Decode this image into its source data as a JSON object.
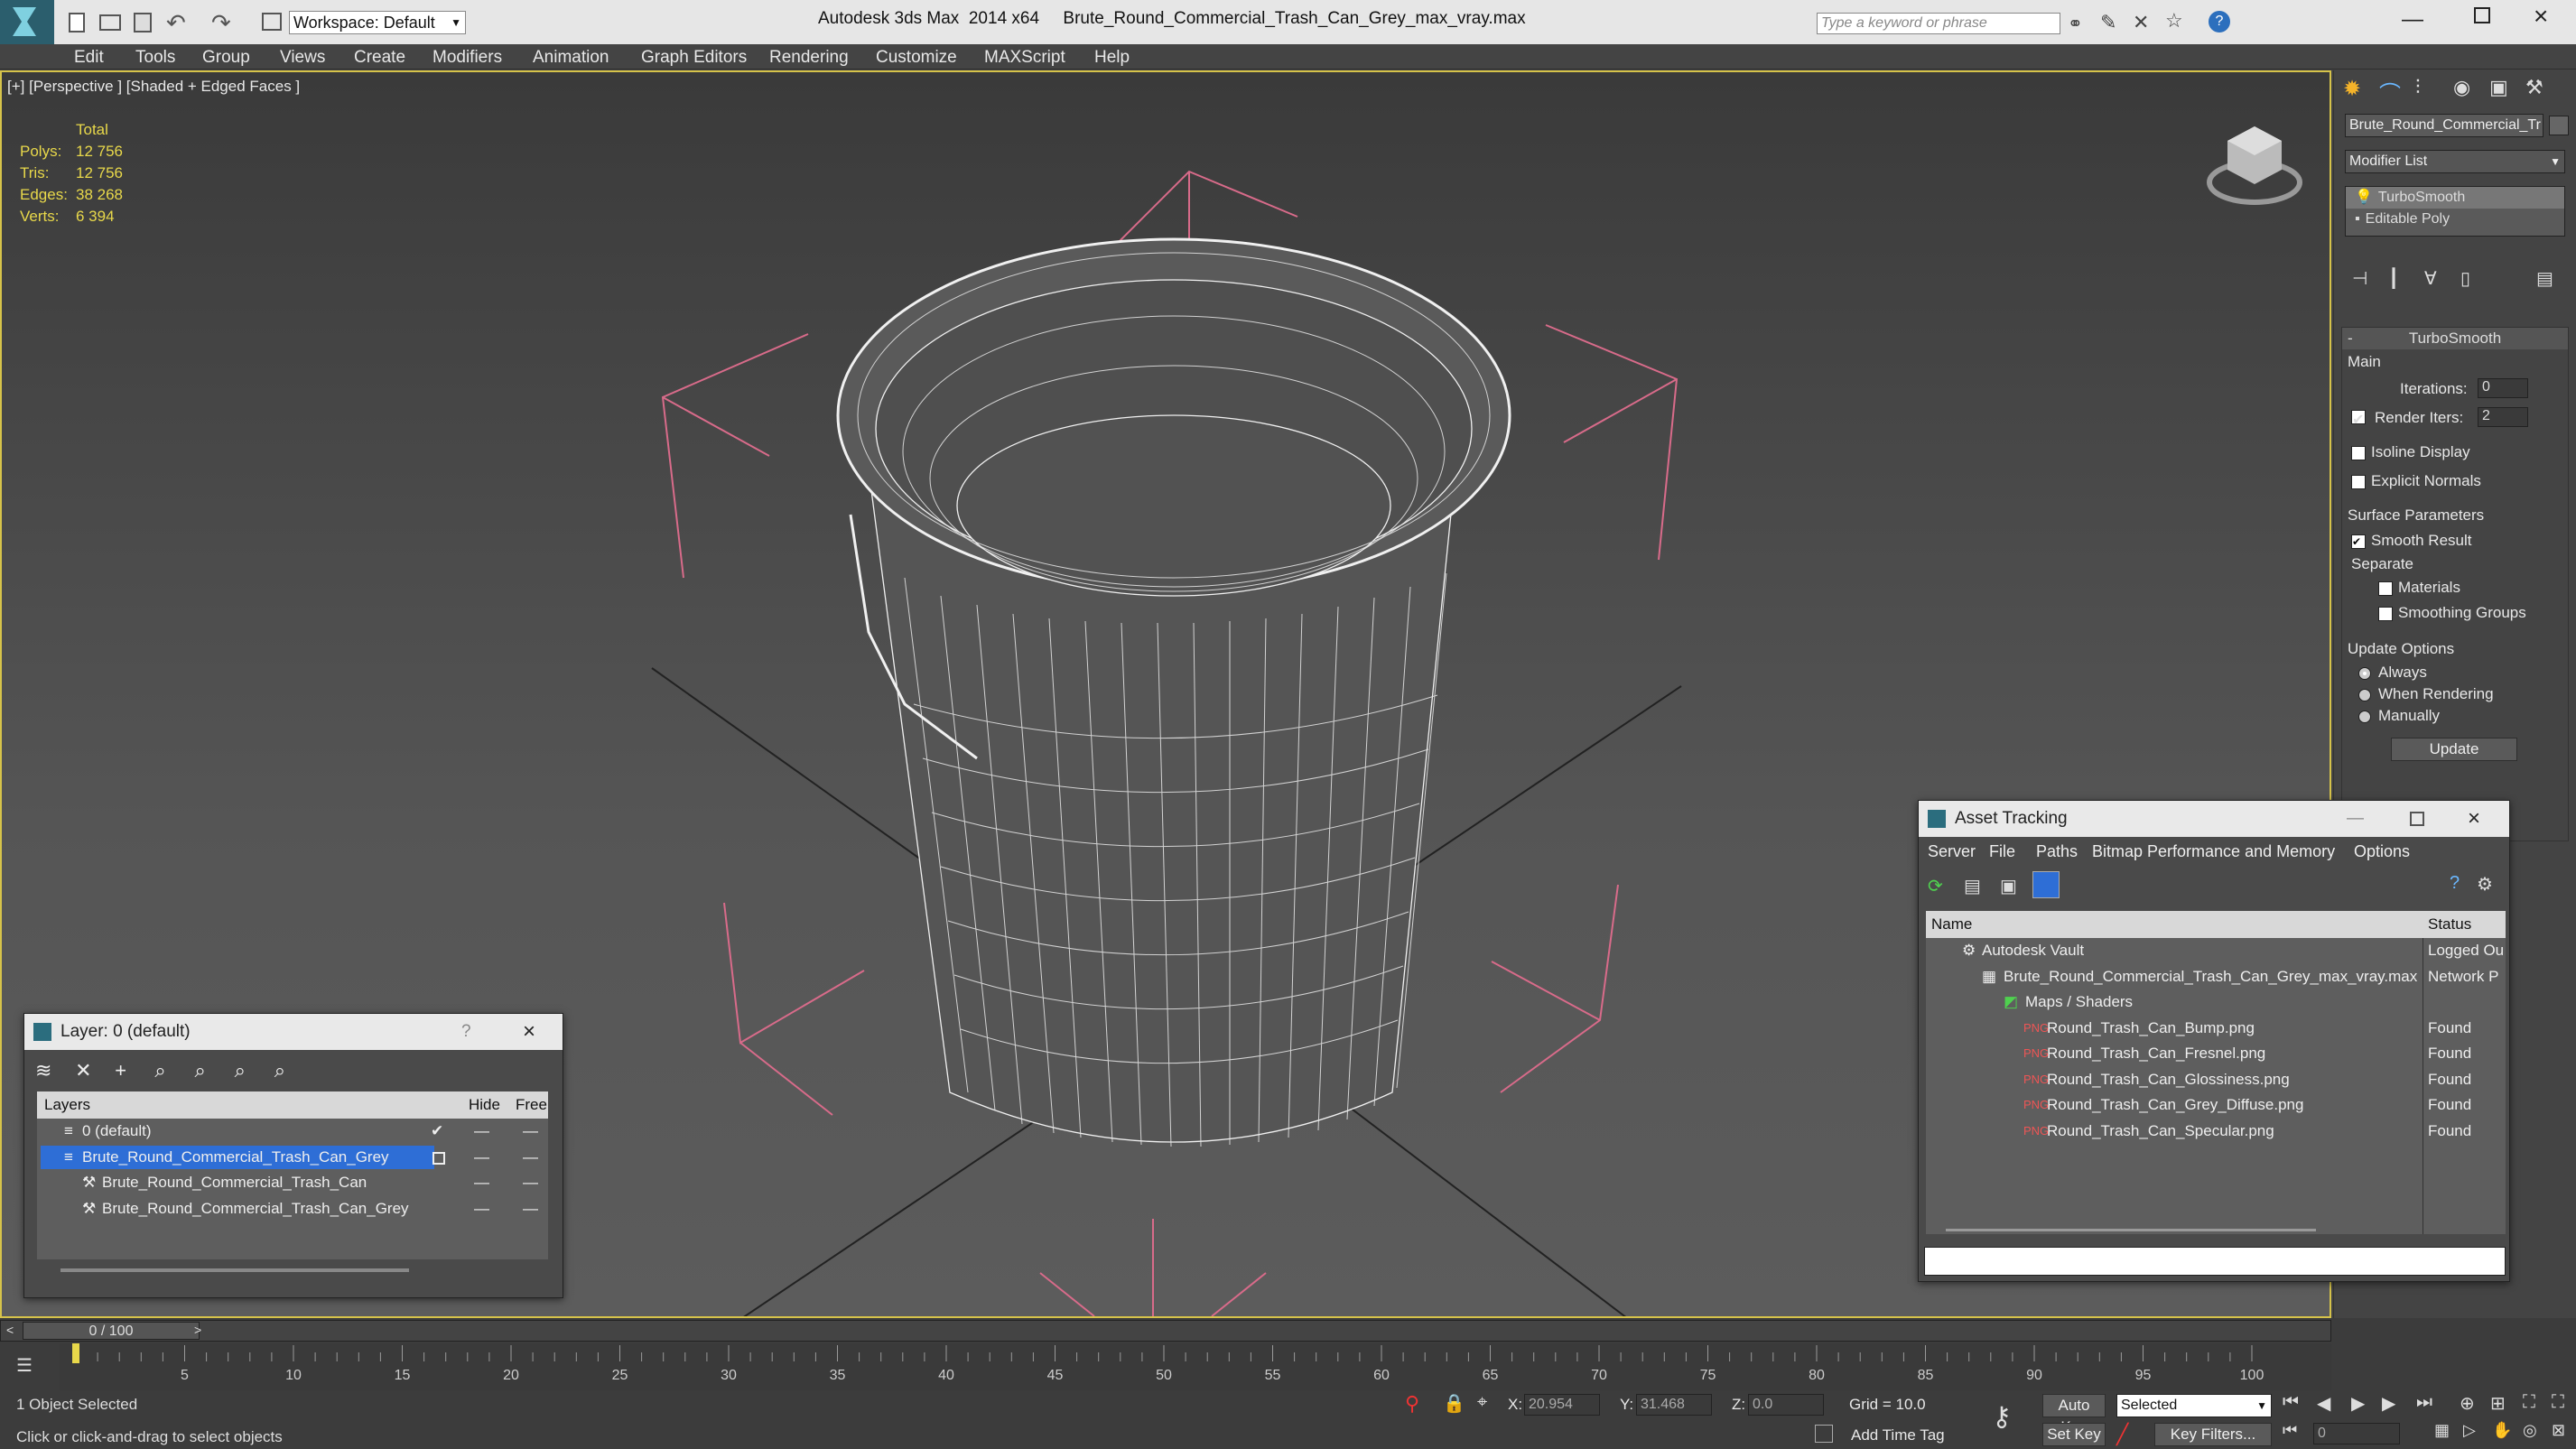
{
  "app": {
    "workspace": "Workspace: Default",
    "title": "Autodesk 3ds Max  2014 x64     Brute_Round_Commercial_Trash_Can_Grey_max_vray.max",
    "search_placeholder": "Type a keyword or phrase"
  },
  "menu": [
    "Edit",
    "Tools",
    "Group",
    "Views",
    "Create",
    "Modifiers",
    "Animation",
    "Graph Editors",
    "Rendering",
    "Customize",
    "MAXScript",
    "Help"
  ],
  "viewport": {
    "label": "[+] [Perspective ] [Shaded + Edged Faces ]",
    "stats": {
      "header": "Total",
      "rows": [
        {
          "label": "Polys:",
          "value": "12 756"
        },
        {
          "label": "Tris:",
          "value": "12 756"
        },
        {
          "label": "Edges:",
          "value": "38 268"
        },
        {
          "label": "Verts:",
          "value": "6 394"
        }
      ]
    }
  },
  "command_panel": {
    "object_name": "Brute_Round_Commercial_Tr",
    "modifier_list": "Modifier List",
    "stack": [
      "TurboSmooth",
      "Editable Poly"
    ],
    "rollout_title": "TurboSmooth",
    "main": "Main",
    "iterations_label": "Iterations:",
    "iterations_value": "0",
    "render_iters_label": "Render Iters:",
    "render_iters_value": "2",
    "isoline": "Isoline Display",
    "explicit_normals": "Explicit Normals",
    "surface_params": "Surface Parameters",
    "smooth_result": "Smooth Result",
    "separate": "Separate",
    "materials": "Materials",
    "smoothing_groups": "Smoothing Groups",
    "update_options": "Update Options",
    "always": "Always",
    "when_rendering": "When Rendering",
    "manually": "Manually",
    "update_button": "Update"
  },
  "layer_dialog": {
    "title": "Layer: 0 (default)",
    "help": "?",
    "col_layers": "Layers",
    "col_hide": "Hide",
    "col_freeze": "Free",
    "rows": [
      {
        "name": "0 (default)",
        "indent": 1
      },
      {
        "name": "Brute_Round_Commercial_Trash_Can_Grey",
        "indent": 1,
        "selected": true
      },
      {
        "name": "Brute_Round_Commercial_Trash_Can",
        "indent": 2
      },
      {
        "name": "Brute_Round_Commercial_Trash_Can_Grey",
        "indent": 2
      }
    ]
  },
  "asset_tracking": {
    "title": "Asset Tracking",
    "menu": [
      "Server",
      "File",
      "Paths",
      "Bitmap Performance and Memory",
      "Options"
    ],
    "col_name": "Name",
    "col_status": "Status",
    "rows": [
      {
        "name": "Autodesk Vault",
        "status": "Logged Ou",
        "indent": 1
      },
      {
        "name": "Brute_Round_Commercial_Trash_Can_Grey_max_vray.max",
        "status": "Network P",
        "indent": 2
      },
      {
        "name": "Maps / Shaders",
        "status": "",
        "indent": 3
      },
      {
        "name": "Round_Trash_Can_Bump.png",
        "status": "Found",
        "indent": 4
      },
      {
        "name": "Round_Trash_Can_Fresnel.png",
        "status": "Found",
        "indent": 4
      },
      {
        "name": "Round_Trash_Can_Glossiness.png",
        "status": "Found",
        "indent": 4
      },
      {
        "name": "Round_Trash_Can_Grey_Diffuse.png",
        "status": "Found",
        "indent": 4
      },
      {
        "name": "Round_Trash_Can_Specular.png",
        "status": "Found",
        "indent": 4
      }
    ]
  },
  "timeline": {
    "frame": "0 / 100",
    "ticks": [
      "5",
      "10",
      "15",
      "20",
      "25",
      "30",
      "35",
      "40",
      "45",
      "50",
      "55",
      "60",
      "65",
      "70",
      "75",
      "80",
      "85",
      "90",
      "95",
      "100"
    ]
  },
  "status": {
    "selected": "1 Object Selected",
    "prompt": "Click or click-and-drag to select objects",
    "x_label": "X:",
    "x_value": "20.954",
    "y_label": "Y:",
    "y_value": "31.468",
    "z_label": "Z:",
    "z_value": "0.0",
    "grid": "Grid = 10.0",
    "add_time_tag": "Add Time Tag",
    "auto_key": "Auto Key",
    "selected_option": "Selected",
    "set_key": "Set Key",
    "key_filters": "Key Filters...",
    "frame_field": "0"
  }
}
